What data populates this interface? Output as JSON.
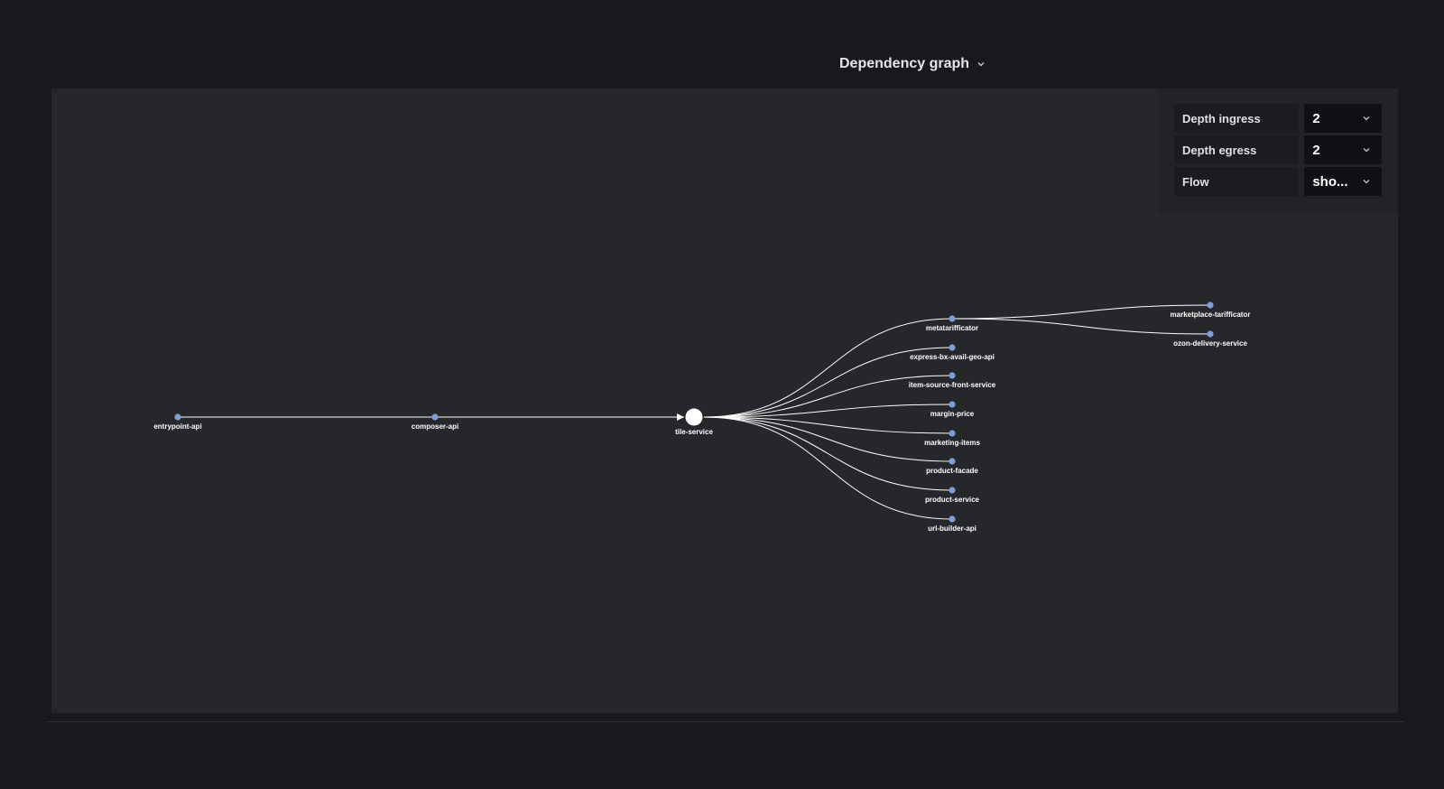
{
  "panel": {
    "title": "Dependency graph"
  },
  "controls": [
    {
      "label": "Depth ingress",
      "value": "2"
    },
    {
      "label": "Depth egress",
      "value": "2"
    },
    {
      "label": "Flow",
      "value": "sho..."
    }
  ],
  "icons": {
    "panel_menu": "chevron-down-icon",
    "select": "chevron-down-icon"
  },
  "colors": {
    "background": "#18191d",
    "panel": "#26272b",
    "node": "#7d9fd6",
    "edge": "#ffffff"
  },
  "graph": {
    "nodes": [
      {
        "id": "entrypoint-api",
        "label": "entrypoint-api"
      },
      {
        "id": "composer-api",
        "label": "composer-api"
      },
      {
        "id": "tile-service",
        "label": "tile-service",
        "focus": true
      },
      {
        "id": "metatarifficator",
        "label": "metatarifficator"
      },
      {
        "id": "express-bx-avail-geo-api",
        "label": "express-bx-avail-geo-api"
      },
      {
        "id": "item-source-front-service",
        "label": "item-source-front-service"
      },
      {
        "id": "margin-price",
        "label": "margin-price"
      },
      {
        "id": "marketing-items",
        "label": "marketing-items"
      },
      {
        "id": "product-facade",
        "label": "product-facade"
      },
      {
        "id": "product-service",
        "label": "product-service"
      },
      {
        "id": "url-builder-api",
        "label": "url-builder-api"
      },
      {
        "id": "marketplace-tarifficator",
        "label": "marketplace-tarifficator"
      },
      {
        "id": "ozon-delivery-service",
        "label": "ozon-delivery-service"
      }
    ],
    "edges": [
      [
        "entrypoint-api",
        "composer-api"
      ],
      [
        "composer-api",
        "tile-service"
      ],
      [
        "tile-service",
        "metatarifficator"
      ],
      [
        "tile-service",
        "express-bx-avail-geo-api"
      ],
      [
        "tile-service",
        "item-source-front-service"
      ],
      [
        "tile-service",
        "margin-price"
      ],
      [
        "tile-service",
        "marketing-items"
      ],
      [
        "tile-service",
        "product-facade"
      ],
      [
        "tile-service",
        "product-service"
      ],
      [
        "tile-service",
        "url-builder-api"
      ],
      [
        "metatarifficator",
        "marketplace-tarifficator"
      ],
      [
        "metatarifficator",
        "ozon-delivery-service"
      ]
    ]
  }
}
